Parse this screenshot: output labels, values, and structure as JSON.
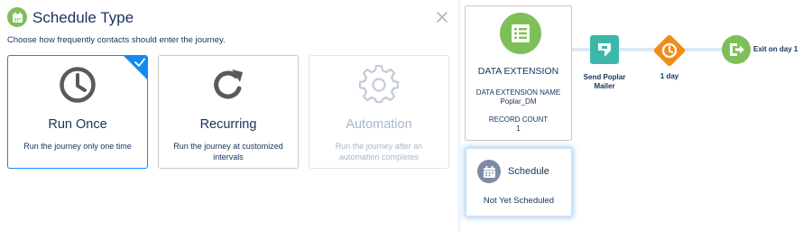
{
  "panel": {
    "title": "Schedule Type",
    "subtitle": "Choose how frequently contacts should enter the journey.",
    "icons": {
      "title": "calendar-icon",
      "close": "close-icon"
    }
  },
  "cards": [
    {
      "title": "Run Once",
      "description": "Run the journey only one time",
      "icon": "clock-icon",
      "selected": true,
      "disabled": false
    },
    {
      "title": "Recurring",
      "description": "Run the journey at customized intervals",
      "icon": "refresh-icon",
      "selected": false,
      "disabled": false
    },
    {
      "title": "Automation",
      "description": "Run the journey after an automation completes",
      "icon": "gear-icon",
      "selected": false,
      "disabled": true
    }
  ],
  "canvas": {
    "entry": {
      "title": "DATA EXTENSION",
      "name_label": "DATA EXTENSION NAME",
      "name_value": "Poplar_DM",
      "count_label": "RECORD COUNT",
      "count_value": "1",
      "icon": "table-icon"
    },
    "schedule": {
      "title": "Schedule",
      "status": "Not Yet Scheduled",
      "icon": "calendar-icon"
    },
    "activities": [
      {
        "label": "Send Poplar Mailer",
        "icon": "mailer-icon",
        "color": "#3bb8a8"
      },
      {
        "label": "1 day",
        "icon": "clock-icon",
        "color": "#f18d16"
      },
      {
        "label": "Exit on day 1",
        "icon": "exit-icon",
        "color": "#7fbf5a"
      }
    ]
  },
  "colors": {
    "accent": "#1589ee",
    "entry_green": "#7fbf5a",
    "text": "#16325c",
    "disabled_text": "#a8b7c7",
    "schedule_icon": "#7d8ba7"
  }
}
